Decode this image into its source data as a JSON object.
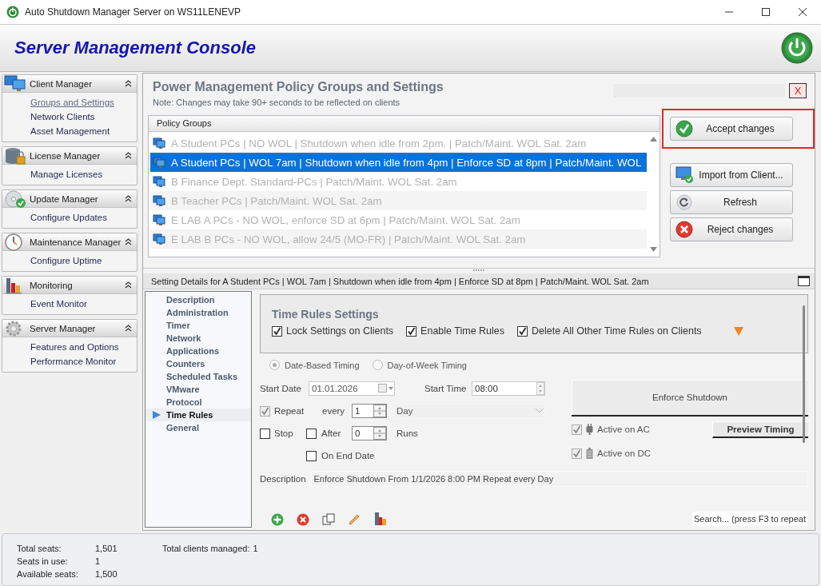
{
  "window": {
    "title": "Auto Shutdown Manager Server on WS11LENEVP"
  },
  "header": {
    "title": "Server Management Console"
  },
  "sidebar": {
    "sections": [
      {
        "title": "Client Manager",
        "kind": "monitors",
        "items": [
          {
            "label": "Groups and Settings",
            "selected": true
          },
          {
            "label": "Network Clients",
            "selected": false
          },
          {
            "label": "Asset Management",
            "selected": false
          }
        ]
      },
      {
        "title": "License Manager",
        "kind": "database",
        "items": [
          {
            "label": "Manage Licenses",
            "selected": false
          }
        ]
      },
      {
        "title": "Update  Manager",
        "kind": "disc",
        "items": [
          {
            "label": "Configure Updates",
            "selected": false
          }
        ]
      },
      {
        "title": "Maintenance Manager",
        "kind": "clock",
        "items": [
          {
            "label": "Configure Uptime",
            "selected": false
          }
        ]
      },
      {
        "title": "Monitoring",
        "kind": "chart",
        "items": [
          {
            "label": "Event Monitor",
            "selected": false
          }
        ]
      },
      {
        "title": "Server Manager",
        "kind": "gear",
        "items": [
          {
            "label": "Features and Options",
            "selected": false
          },
          {
            "label": "Performance Monitor",
            "selected": false
          }
        ]
      }
    ]
  },
  "policy_panel": {
    "title": "Power Management Policy Groups and Settings",
    "note": "Note: Changes may take 90+ seconds to be reflected on clients",
    "close_button": "X",
    "groups_header": "Policy Groups",
    "groups": [
      {
        "label": "A Student PCs | NO WOL | Shutdown when idle from 2pm. | Patch/Maint. WOL Sat. 2am",
        "selected": false
      },
      {
        "label": "A Student PCs | WOL 7am | Shutdown when idle from 4pm | Enforce SD at 8pm | Patch/Maint. WOL",
        "selected": true
      },
      {
        "label": "B Finance Dept. Standard-PCs | Patch/Maint. WOL Sat. 2am",
        "selected": false
      },
      {
        "label": "B Teacher PCs | Patch/Maint. WOL Sat. 2am",
        "selected": false
      },
      {
        "label": "E LAB A PCs - NO WOL, enforce SD at 6pm | Patch/Maint. WOL Sat. 2am",
        "selected": false
      },
      {
        "label": "E LAB B PCs - NO WOL, allow 24/5 (MO-FR) | Patch/Maint. WOL Sat. 2am",
        "selected": false
      }
    ]
  },
  "actions": [
    {
      "label": "Accept changes",
      "kind": "accept",
      "highlighted": true
    },
    {
      "label": "Import from  Client...",
      "kind": "import",
      "highlighted": false
    },
    {
      "label": "Refresh",
      "kind": "refresh",
      "highlighted": false
    },
    {
      "label": "Reject changes",
      "kind": "reject",
      "highlighted": false
    }
  ],
  "details": {
    "header": "Setting Details for A Student PCs | WOL 7am | Shutdown when idle from 4pm | Enforce SD at 8pm | Patch/Maint. WOL Sat. 2am",
    "nav": [
      {
        "label": "Description",
        "selected": false
      },
      {
        "label": "Administration",
        "selected": false
      },
      {
        "label": "Timer",
        "selected": false
      },
      {
        "label": "Network",
        "selected": false
      },
      {
        "label": "Applications",
        "selected": false
      },
      {
        "label": "Counters",
        "selected": false
      },
      {
        "label": "Scheduled Tasks",
        "selected": false
      },
      {
        "label": "VMware",
        "selected": false
      },
      {
        "label": "Protocol",
        "selected": false
      },
      {
        "label": "Time Rules",
        "selected": true
      },
      {
        "label": "General",
        "selected": false
      }
    ],
    "settings_title": "Time Rules Settings",
    "options": [
      {
        "label": "Lock Settings on Clients",
        "checked": true
      },
      {
        "label": "Enable Time Rules",
        "checked": true
      },
      {
        "label": "Delete All Other Time Rules on Clients",
        "checked": true
      }
    ],
    "timing": [
      {
        "label": "Date-Based Timing",
        "selected": true
      },
      {
        "label": "Day-of-Week Timing",
        "selected": false
      }
    ],
    "start_date_label": "Start Date",
    "start_date": "01.01.2026",
    "start_time_label": "Start Time",
    "start_time": "08:00",
    "repeat": {
      "label": "Repeat",
      "checked": true
    },
    "every_label": "every",
    "every_value": "1",
    "period": "Day",
    "stop": {
      "label": "Stop",
      "checked": false
    },
    "after": {
      "label": "After",
      "checked": false
    },
    "runs_value": "0",
    "runs_label": "Runs",
    "on_end_date": {
      "label": "On End Date",
      "checked": false
    },
    "action_button": "Enforce Shutdown",
    "active_on_ac": {
      "label": "Active on AC",
      "checked": true
    },
    "preview_button": "Preview Timing",
    "active_on_dc": {
      "label": "Active on DC",
      "checked": true
    },
    "description_label": "Description",
    "description": "Enforce Shutdown From 1/1/2026 8:00 PM Repeat every Day",
    "search_placeholder": "Search... (press F3 to repeat"
  },
  "status": {
    "total_seats_label": "Total seats:",
    "total_seats": "1,501",
    "seats_in_use_label": "Seats in use:",
    "seats_in_use": "1",
    "available_label": "Available seats:",
    "available": "1,500",
    "clients_label": "Total clients managed:",
    "clients": "1"
  }
}
